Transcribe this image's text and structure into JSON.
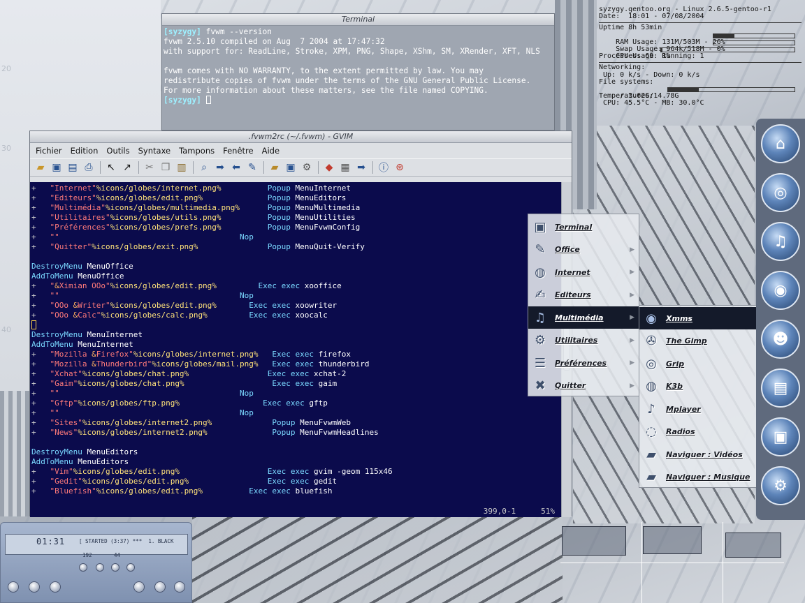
{
  "desktop": {
    "decor_labels": [
      "20",
      "30",
      "40"
    ]
  },
  "terminal": {
    "title": "Terminal",
    "lines": [
      {
        "prompt": "[syzygy]",
        "text": " fvwm --version"
      },
      {
        "prompt": "",
        "text": "fvwm 2.5.10 compiled on Aug  7 2004 at 17:47:32"
      },
      {
        "prompt": "",
        "text": "with support for: ReadLine, Stroke, XPM, PNG, Shape, XShm, SM, XRender, XFT, NLS"
      },
      {
        "prompt": "",
        "text": " "
      },
      {
        "prompt": "",
        "text": "fvwm comes with NO WARRANTY, to the extent permitted by law. You may"
      },
      {
        "prompt": "",
        "text": "redistribute copies of fvwm under the terms of the GNU General Public License."
      },
      {
        "prompt": "",
        "text": "For more information about these matters, see the file named COPYING."
      },
      {
        "prompt": "[syzygy]",
        "text": " "
      }
    ]
  },
  "sysmon": {
    "header": "syzygy.gentoo.org - Linux 2.6.5-gentoo-r1",
    "date": "Date:  18:01 - 07/08/2004",
    "uptime": "Uptime 8h 53min",
    "ram": "RAM Usage: 131M/503M - 26%",
    "ram_fraction": 0.26,
    "swap": "Swap Usage: 964k/518M - 0%",
    "swap_fraction": 0.0,
    "cpu": "CPU Usage: 1%",
    "cpu_fraction": 0.01,
    "processes": "Processes: 69  Running: 1",
    "networking": "Networking:",
    "net_rates": " Up: 0 k/s - Down: 0 k/s",
    "filesystems": "File systems:",
    "fs_root": " / 3.62G/14.78G",
    "fs_fraction": 0.245,
    "temperatures": "Temperatures:",
    "temp_values": " CPU: 45.5°C - MB: 30.0°C"
  },
  "gvim": {
    "title": ".fvwm2rc (~/.fvwm) - GVIM",
    "menu": [
      "Fichier",
      "Edition",
      "Outils",
      "Syntaxe",
      "Tampons",
      "Fenêtre",
      "Aide"
    ],
    "status_pos": "399,0-1",
    "status_pct": "51%"
  },
  "root_menu": {
    "items": [
      {
        "label": "Terminal",
        "icon": "terminal-icon"
      },
      {
        "label": "Office",
        "icon": "office-icon"
      },
      {
        "label": "Internet",
        "icon": "internet-icon"
      },
      {
        "label": "Editeurs",
        "icon": "editor-icon"
      },
      {
        "label": "Multimédia",
        "icon": "multimedia-icon"
      },
      {
        "label": "Utilitaires",
        "icon": "gear-icon"
      },
      {
        "label": "Préférences",
        "icon": "preferences-icon"
      },
      {
        "label": "Quitter",
        "icon": "quit-icon"
      }
    ]
  },
  "multimedia_menu": {
    "items": [
      {
        "label": "Xmms",
        "icon": "xmms-icon"
      },
      {
        "label": "The Gimp",
        "icon": "gimp-icon"
      },
      {
        "label": "Grip",
        "icon": "cd-icon"
      },
      {
        "label": "K3b",
        "icon": "k3b-icon"
      },
      {
        "label": "Mplayer",
        "icon": "mplayer-icon"
      },
      {
        "label": "Radios",
        "icon": "radio-icon"
      },
      {
        "label": "Naviguer : Vidéos",
        "icon": "folder-icon"
      },
      {
        "label": "Naviguer : Musique",
        "icon": "folder-icon"
      }
    ]
  },
  "xmms": {
    "time": "01:31",
    "track": "[ STARTED (3:37) ***  1. BLACK",
    "bitrate": "192",
    "frequency": "44"
  }
}
